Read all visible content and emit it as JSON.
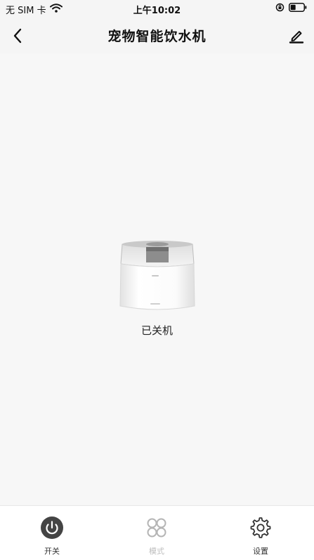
{
  "status_bar": {
    "carrier": "无 SIM 卡",
    "time": "上午10:02"
  },
  "nav": {
    "title": "宠物智能饮水机"
  },
  "device": {
    "status_text": "已关机"
  },
  "tabs": [
    {
      "label": "开关",
      "icon": "power-icon",
      "enabled": true
    },
    {
      "label": "模式",
      "icon": "mode-grid-icon",
      "enabled": false
    },
    {
      "label": "设置",
      "icon": "gear-icon",
      "enabled": true
    }
  ]
}
